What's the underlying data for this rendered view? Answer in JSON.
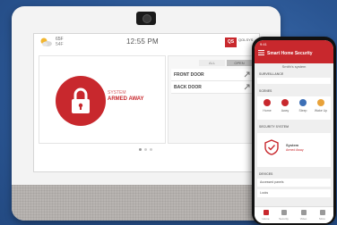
{
  "panel": {
    "weather": {
      "temp_high": "65F",
      "temp_low": "54F"
    },
    "clock": "12:55 PM",
    "brand": {
      "logo_text": "QS",
      "text": "QOLSYS"
    },
    "system_label": "SYSTEM",
    "armed_status": "ARMED AWAY",
    "filters": [
      "ALL",
      "OPEN"
    ],
    "sensors": [
      {
        "name": "FRONT DOOR"
      },
      {
        "name": "BACK DOOR"
      }
    ],
    "accent_color": "#c8282d"
  },
  "phone": {
    "status_time": "9:41",
    "title": "Smart Home Security",
    "subtitle": "Smith's system",
    "sections": {
      "first": "SURVEILLANCE",
      "scenes": "SCENES",
      "security": "SECURITY SYSTEM",
      "devices": "DEVICES",
      "rows": [
        "Accessed panels",
        "Locks"
      ]
    },
    "scenes": [
      {
        "label": "Home",
        "color": "#c8282d"
      },
      {
        "label": "Away",
        "color": "#c8282d"
      },
      {
        "label": "Sleep",
        "color": "#3c6fb6"
      },
      {
        "label": "Wake Up",
        "color": "#e8a23a"
      }
    ],
    "security": {
      "system_text": "System",
      "status": "Armed Away"
    },
    "nav": [
      "Home",
      "Security",
      "Video",
      "More"
    ]
  }
}
